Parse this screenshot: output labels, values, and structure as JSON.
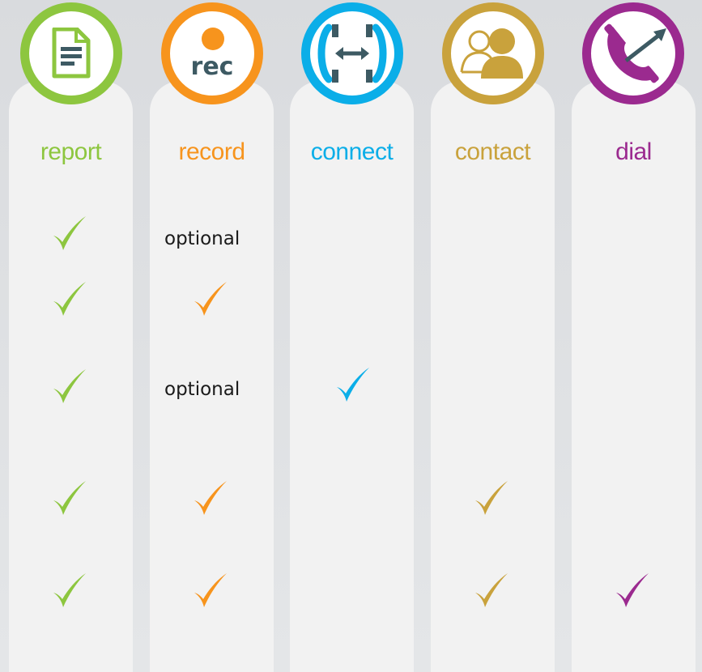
{
  "features": [
    {
      "id": "report",
      "label": "report",
      "color": "#8dc63f"
    },
    {
      "id": "record",
      "label": "record",
      "color": "#f7941d"
    },
    {
      "id": "connect",
      "label": "connect",
      "color": "#0baee8"
    },
    {
      "id": "contact",
      "label": "contact",
      "color": "#c9a23c"
    },
    {
      "id": "dial",
      "label": "dial",
      "color": "#9b2a8f"
    }
  ],
  "record_icon_text": "rec",
  "rows": [
    {
      "report": "check",
      "record": "optional",
      "connect": "",
      "contact": "",
      "dial": ""
    },
    {
      "report": "check",
      "record": "check",
      "connect": "",
      "contact": "",
      "dial": ""
    },
    {
      "report": "check",
      "record": "optional",
      "connect": "check",
      "contact": "",
      "dial": ""
    },
    {
      "report": "check",
      "record": "check",
      "connect": "",
      "contact": "check",
      "dial": ""
    },
    {
      "report": "check",
      "record": "check",
      "connect": "",
      "contact": "check",
      "dial": "check"
    }
  ],
  "optional_text": "optional"
}
